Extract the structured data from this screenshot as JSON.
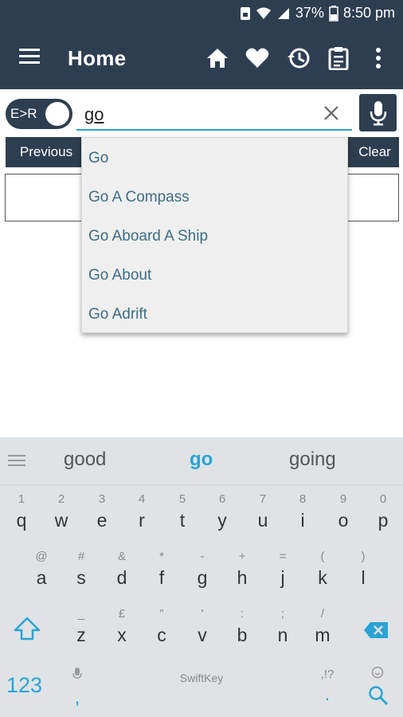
{
  "status": {
    "battery": "37%",
    "time": "8:50 pm"
  },
  "appbar": {
    "title": "Home",
    "icons": [
      "menu-icon",
      "home-icon",
      "heart-icon",
      "history-icon",
      "clipboard-icon",
      "more-vert-icon"
    ]
  },
  "search": {
    "mode_label": "E>R",
    "value": "go"
  },
  "buttons": {
    "previous": "Previous",
    "clear": "Clear"
  },
  "suggestions": [
    "Go",
    "Go A Compass",
    "Go Aboard A Ship",
    "Go About",
    "Go Adrift"
  ],
  "keyboard": {
    "predictions": [
      "good",
      "go",
      "going"
    ],
    "row1": [
      {
        "hint": "1",
        "key": "q"
      },
      {
        "hint": "2",
        "key": "w"
      },
      {
        "hint": "3",
        "key": "e"
      },
      {
        "hint": "4",
        "key": "r"
      },
      {
        "hint": "5",
        "key": "t"
      },
      {
        "hint": "6",
        "key": "y"
      },
      {
        "hint": "7",
        "key": "u"
      },
      {
        "hint": "8",
        "key": "i"
      },
      {
        "hint": "9",
        "key": "o"
      },
      {
        "hint": "0",
        "key": "p"
      }
    ],
    "row2": [
      {
        "hint": "@",
        "key": "a"
      },
      {
        "hint": "#",
        "key": "s"
      },
      {
        "hint": "&",
        "key": "d"
      },
      {
        "hint": "*",
        "key": "f"
      },
      {
        "hint": "-",
        "key": "g"
      },
      {
        "hint": "+",
        "key": "h"
      },
      {
        "hint": "=",
        "key": "j"
      },
      {
        "hint": "(",
        "key": "k"
      },
      {
        "hint": ")",
        "key": "l"
      }
    ],
    "row3": [
      {
        "hint": "_",
        "key": "z"
      },
      {
        "hint": "£",
        "key": "x"
      },
      {
        "hint": "\"",
        "key": "c"
      },
      {
        "hint": "'",
        "key": "v"
      },
      {
        "hint": ":",
        "key": "b"
      },
      {
        "hint": ";",
        "key": "n"
      },
      {
        "hint": "/",
        "key": "m"
      }
    ],
    "numbers_label": "123",
    "comma": ",",
    "period": ".",
    "period_hint": ",!?",
    "space_label": "SwiftKey"
  },
  "colors": {
    "primary": "#2e3e51",
    "accent": "#2aa3d6",
    "suggestion_text": "#3d6d86"
  }
}
